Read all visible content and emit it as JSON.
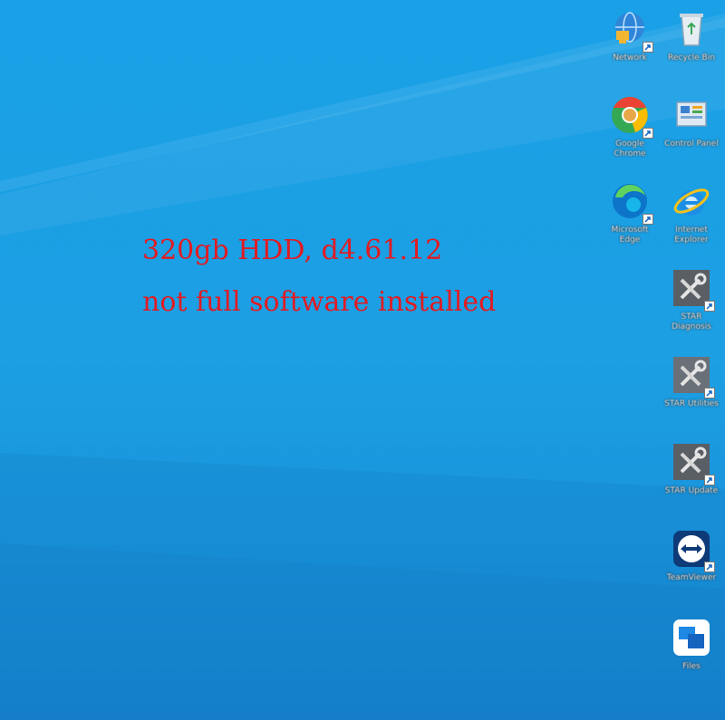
{
  "overlay": {
    "line1": "320gb HDD, d4.61.12",
    "line2": "not full software installed",
    "color": "#e21b22"
  },
  "desktop": {
    "background": "#1c9fe3",
    "icons": [
      {
        "name": "network-icon",
        "label": "Network"
      },
      {
        "name": "recycle-bin-icon",
        "label": "Recycle Bin"
      },
      {
        "name": "chrome-icon",
        "label": "Google Chrome"
      },
      {
        "name": "control-panel-icon",
        "label": "Control Panel"
      },
      {
        "name": "edge-icon",
        "label": "Microsoft Edge"
      },
      {
        "name": "internet-explorer-icon",
        "label": "Internet Explorer"
      },
      {
        "name": "tools-icon",
        "label": "STAR Diagnosis"
      },
      {
        "name": "tools-icon",
        "label": "STAR Utilities"
      },
      {
        "name": "tools-icon",
        "label": "STAR Update"
      },
      {
        "name": "teamviewer-icon",
        "label": "TeamViewer"
      },
      {
        "name": "app-icon",
        "label": "Files"
      }
    ]
  }
}
